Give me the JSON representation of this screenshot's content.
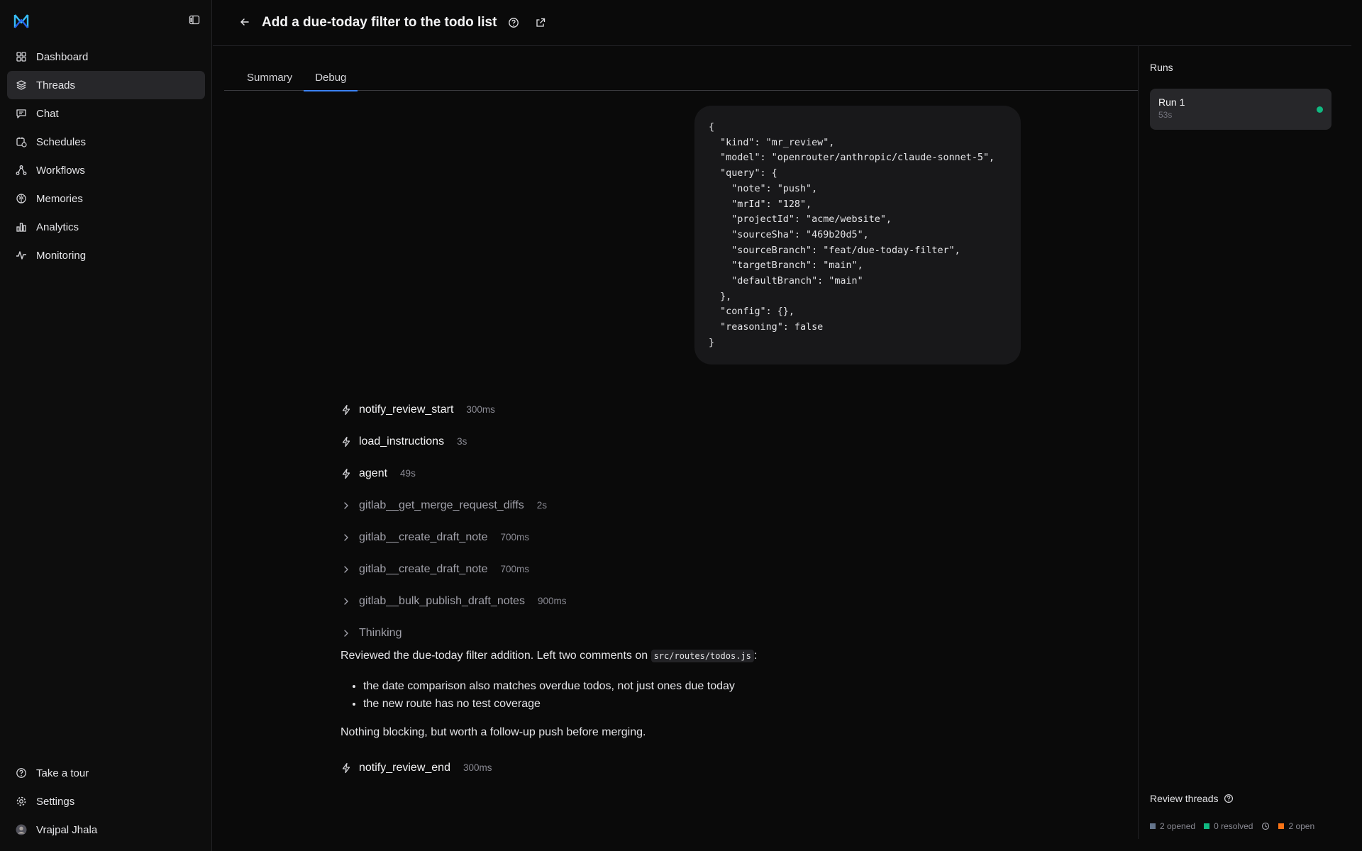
{
  "colors": {
    "accent": "#3b82f6",
    "success": "#10b981",
    "opened": "#64748b",
    "resolved": "#10b981",
    "open": "#f97316"
  },
  "sidebar": {
    "items": [
      {
        "label": "Dashboard",
        "icon": "dashboard-icon"
      },
      {
        "label": "Threads",
        "icon": "layers-icon"
      },
      {
        "label": "Chat",
        "icon": "chat-icon"
      },
      {
        "label": "Schedules",
        "icon": "calendar-clock-icon"
      },
      {
        "label": "Workflows",
        "icon": "workflow-icon"
      },
      {
        "label": "Memories",
        "icon": "brain-icon"
      },
      {
        "label": "Analytics",
        "icon": "bar-chart-icon"
      },
      {
        "label": "Monitoring",
        "icon": "activity-icon"
      }
    ],
    "bottom": [
      {
        "label": "Take a tour",
        "icon": "help-circle-icon"
      },
      {
        "label": "Settings",
        "icon": "gear-icon"
      },
      {
        "label": "Vrajpal Jhala",
        "icon": "avatar"
      }
    ]
  },
  "header": {
    "title": "Add a due-today filter to the todo list"
  },
  "tabs": [
    "Summary",
    "Debug"
  ],
  "debug": {
    "json_text": "{\n  \"kind\": \"mr_review\",\n  \"model\": \"openrouter/anthropic/claude-sonnet-5\",\n  \"query\": {\n    \"note\": \"push\",\n    \"mrId\": \"128\",\n    \"projectId\": \"acme/website\",\n    \"sourceSha\": \"469b20d5\",\n    \"sourceBranch\": \"feat/due-today-filter\",\n    \"targetBranch\": \"main\",\n    \"defaultBranch\": \"main\"\n  },\n  \"config\": {},\n  \"reasoning\": false\n}",
    "steps": [
      {
        "name": "notify_review_start",
        "duration": "300ms"
      },
      {
        "name": "load_instructions",
        "duration": "3s"
      },
      {
        "name": "agent",
        "duration": "49s"
      },
      {
        "name": "gitlab__get_merge_request_diffs",
        "duration": "2s"
      },
      {
        "name": "gitlab__create_draft_note",
        "duration": "700ms"
      },
      {
        "name": "gitlab__create_draft_note",
        "duration": "700ms"
      },
      {
        "name": "gitlab__bulk_publish_draft_notes",
        "duration": "900ms"
      },
      {
        "name": "Thinking"
      }
    ],
    "message": {
      "intro": "Reviewed the due-today filter addition. Left two comments on ",
      "file": "src/routes/todos.js",
      "colon": ":",
      "bullets": [
        "the date comparison also matches overdue todos, not just ones due today",
        "the new route has no test coverage"
      ],
      "outro": "Nothing blocking, but worth a follow-up push before merging."
    },
    "end_step": {
      "name": "notify_review_end",
      "duration": "300ms"
    }
  },
  "runs": {
    "title": "Runs",
    "items": [
      {
        "name": "Run 1",
        "duration": "53s"
      }
    ]
  },
  "review_threads": {
    "title": "Review threads",
    "opened": "2 opened",
    "resolved": "0 resolved",
    "open": "2 open"
  }
}
